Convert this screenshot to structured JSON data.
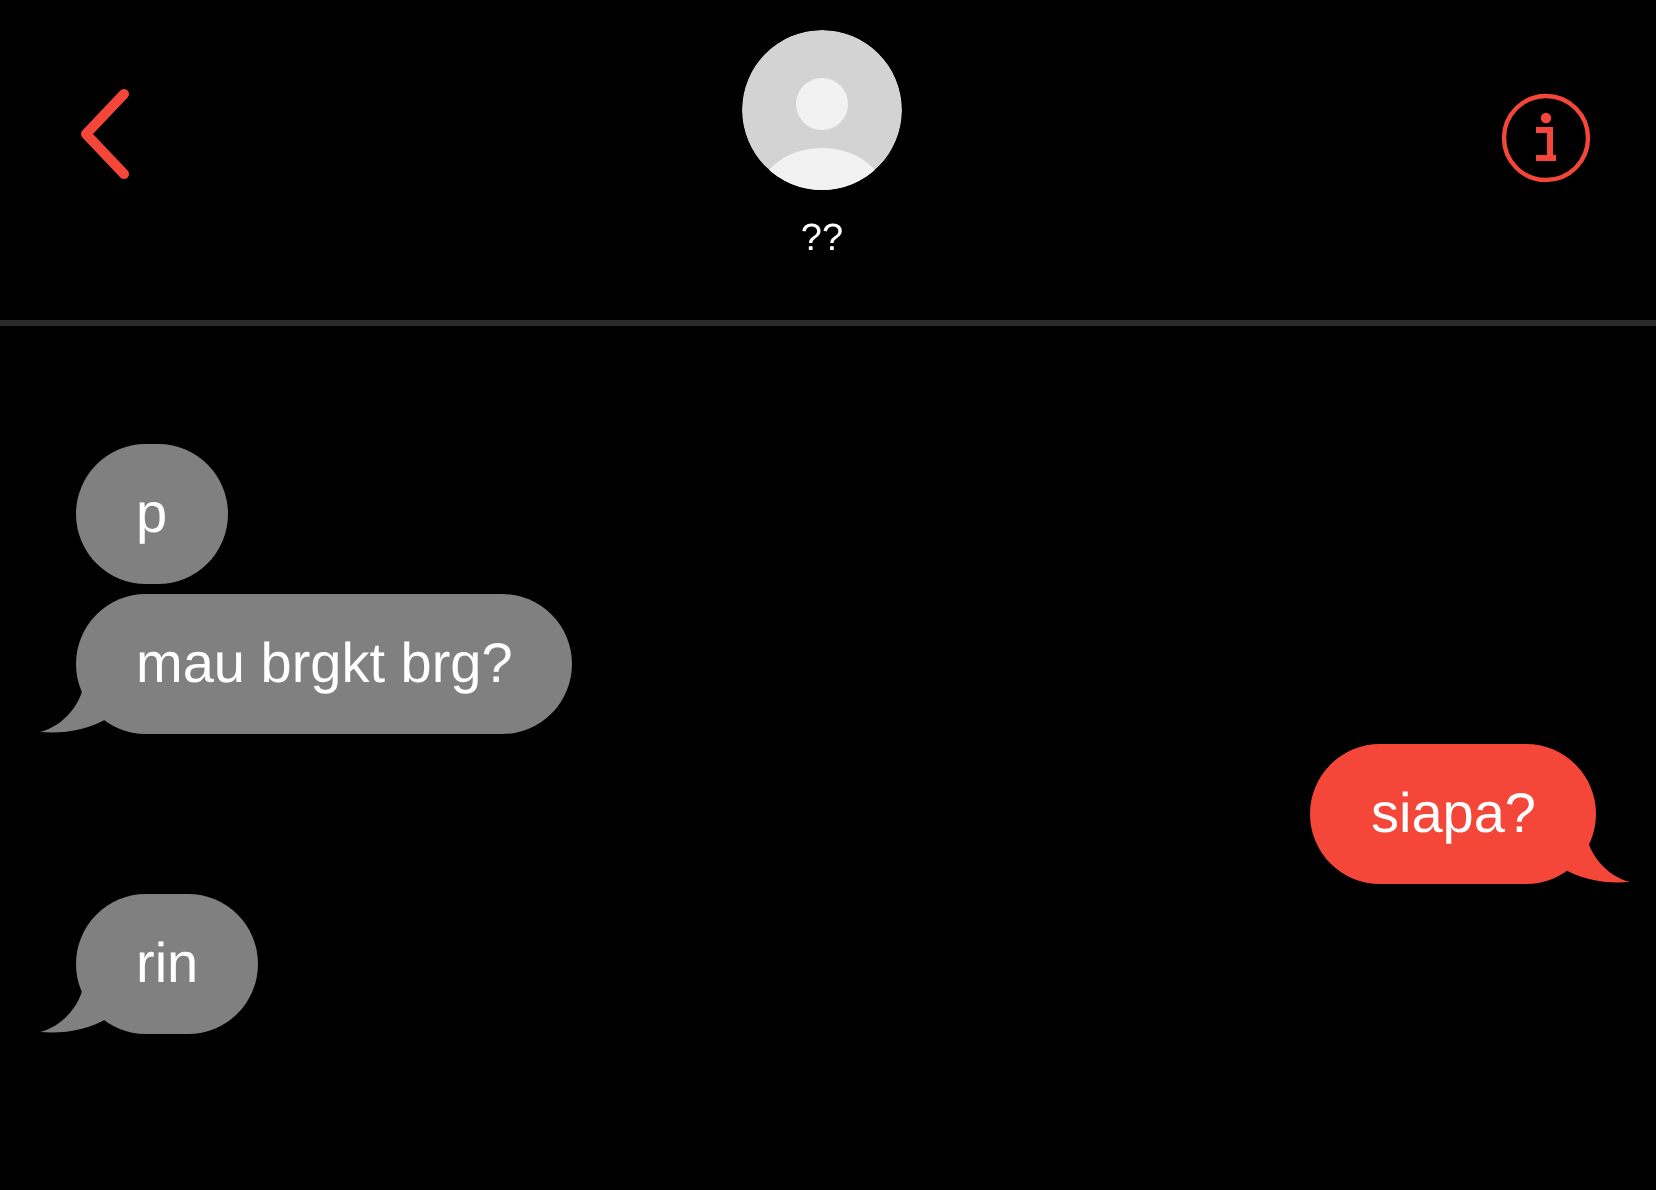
{
  "header": {
    "contact_name": "??"
  },
  "messages": [
    {
      "kind": "incoming",
      "text": "p",
      "tail": false
    },
    {
      "kind": "incoming",
      "text": "mau brgkt brg?",
      "tail": true
    },
    {
      "kind": "outgoing",
      "text": "siapa?",
      "tail": true
    },
    {
      "kind": "incoming",
      "text": "rin",
      "tail": true
    }
  ]
}
